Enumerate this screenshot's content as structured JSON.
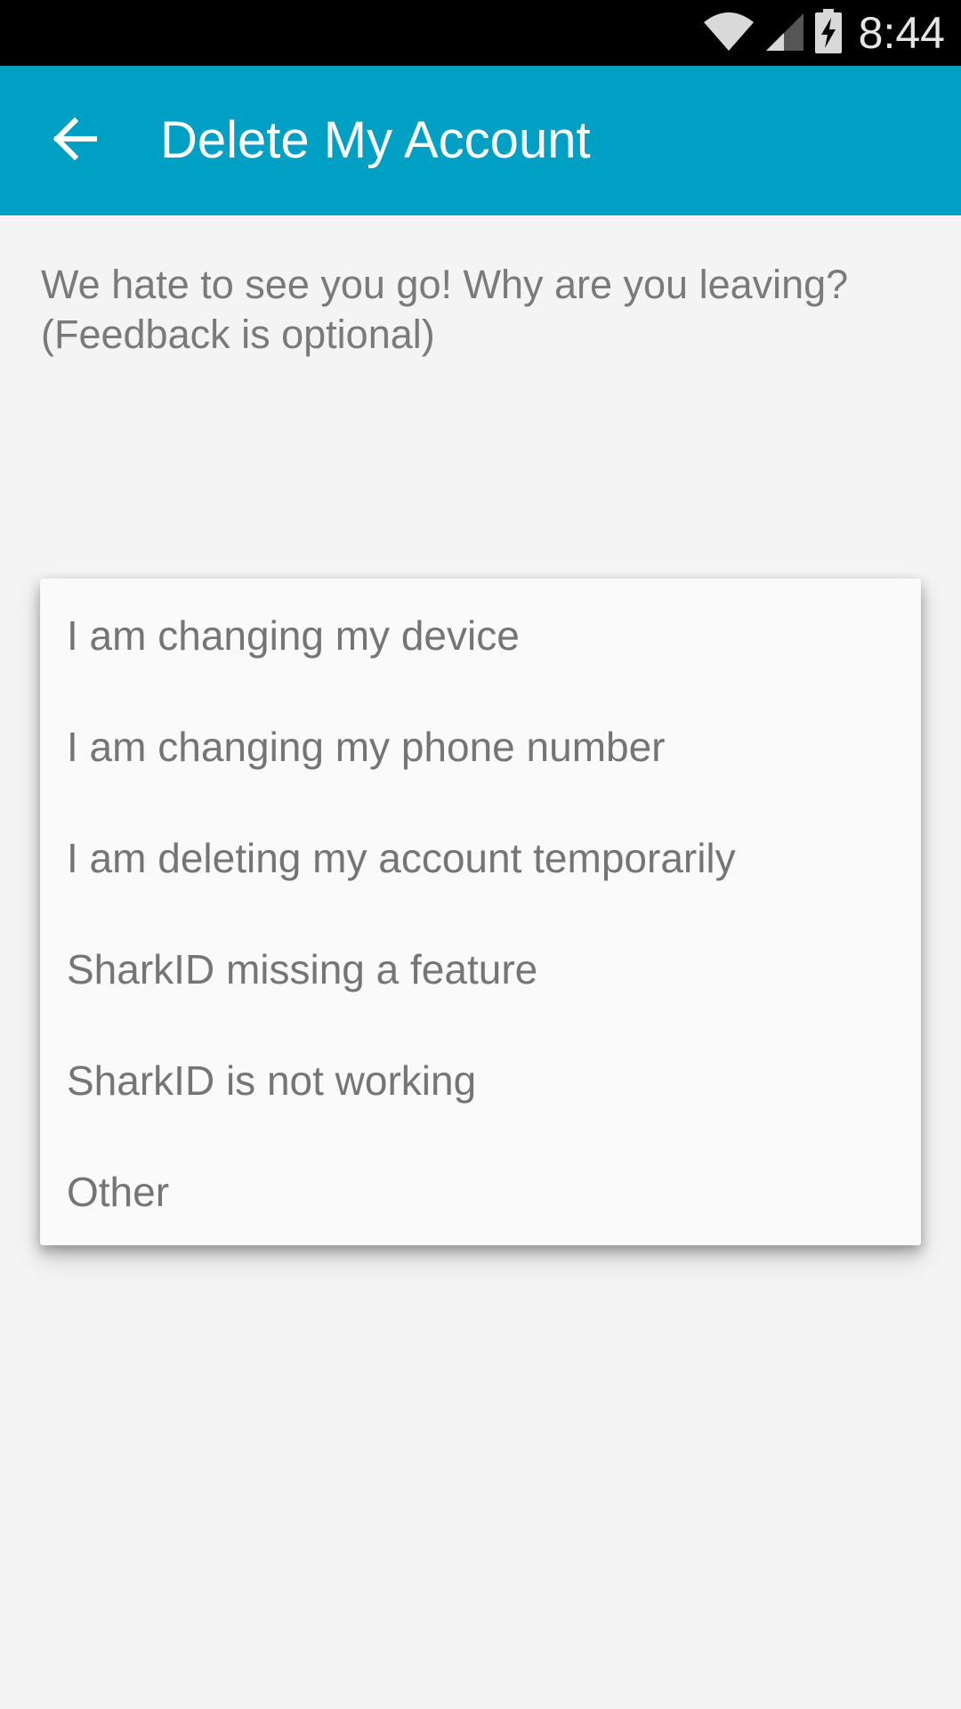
{
  "status_bar": {
    "time": "8:44",
    "icons": [
      "wifi-icon",
      "signal-icon",
      "battery-charging-icon"
    ]
  },
  "app_bar": {
    "title": "Delete My Account",
    "back_icon": "arrow-back-icon",
    "background": "#00a0c4"
  },
  "prompt": {
    "line1": "We hate to see you go! Why are you leaving?",
    "line2": "(Feedback is optional)"
  },
  "dropdown": {
    "options": [
      "I am changing my device",
      "I am changing my phone number",
      "I am deleting my account temporarily",
      "SharkID missing a feature",
      "SharkID is not working",
      "Other"
    ]
  }
}
